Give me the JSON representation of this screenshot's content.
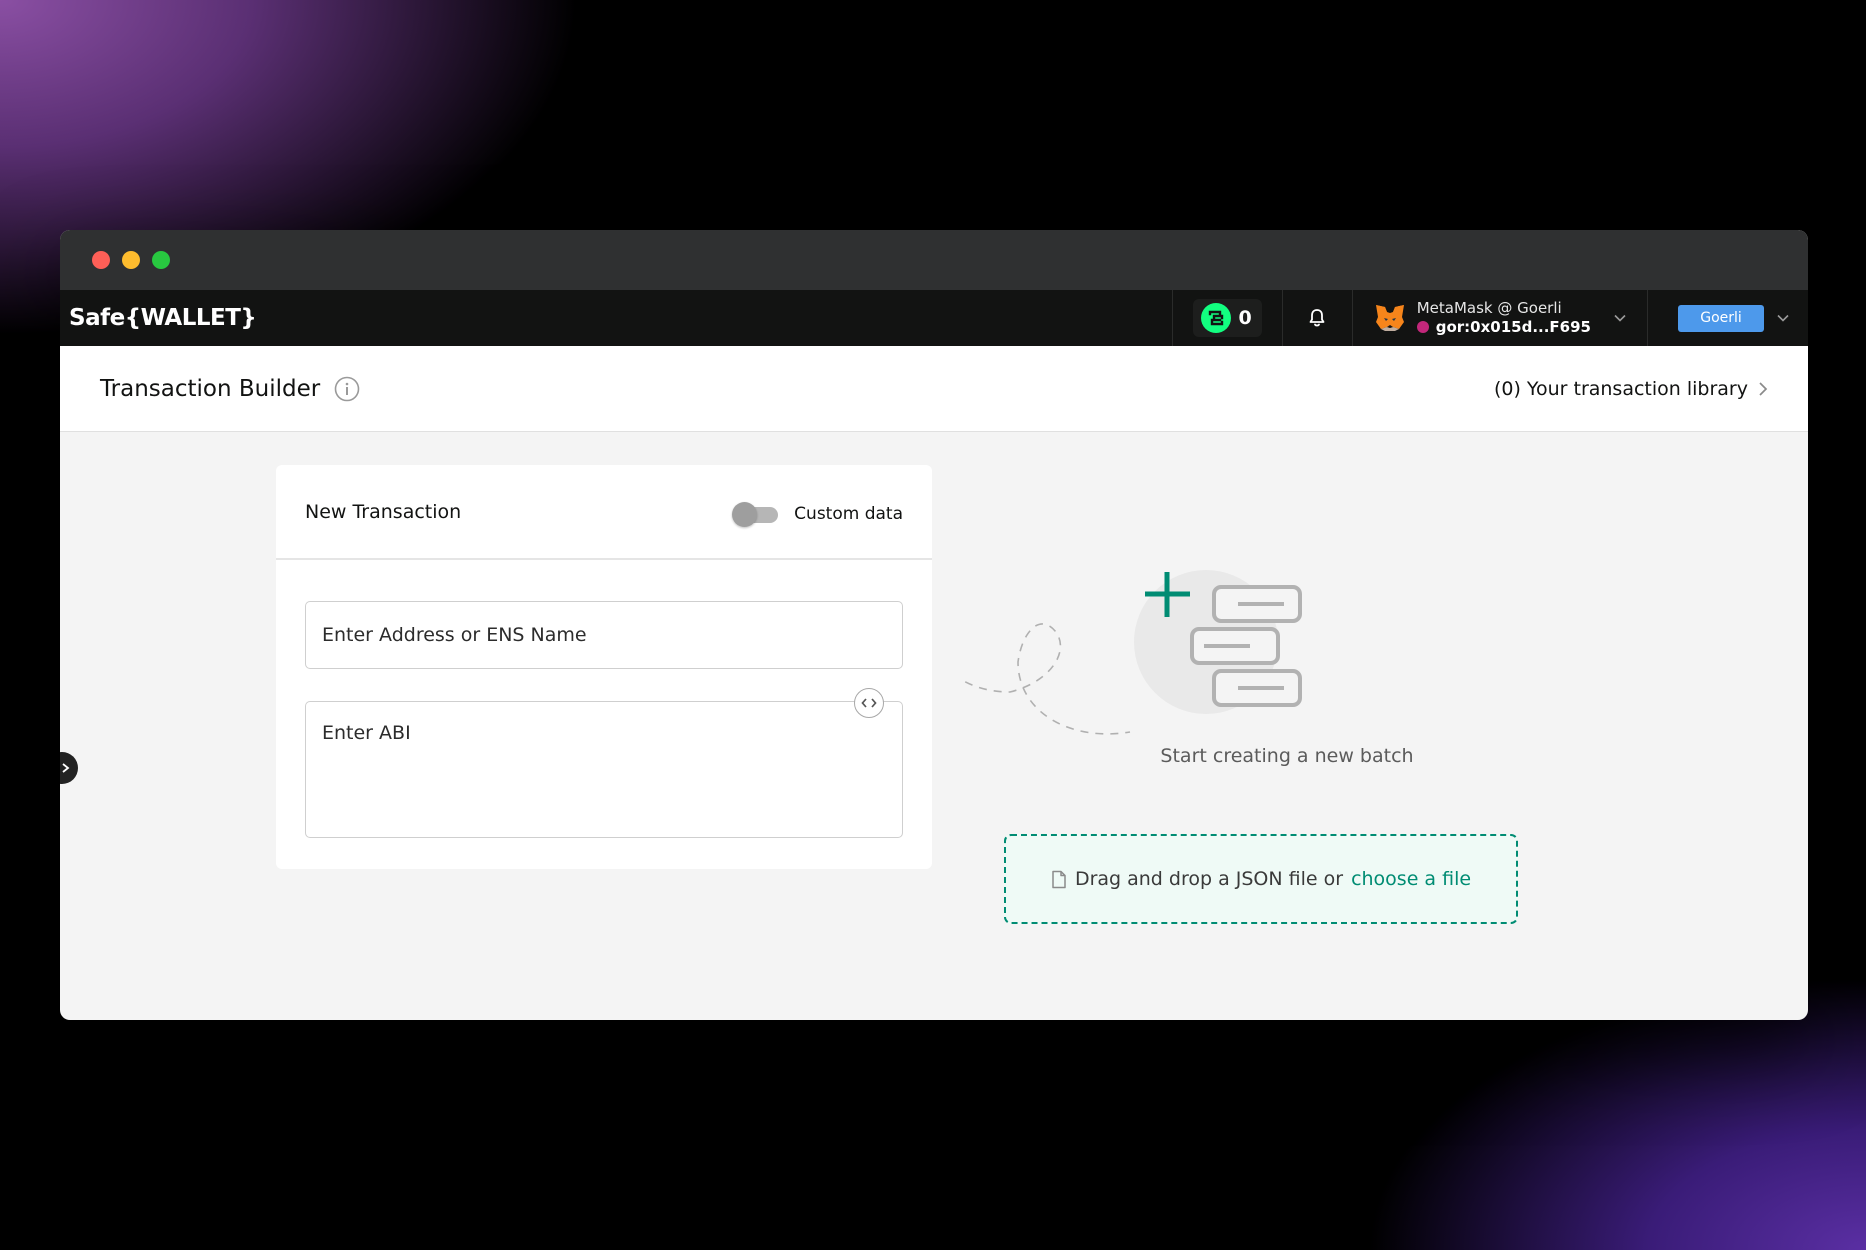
{
  "app": {
    "logo_text": "Safe{WALLET}",
    "pending_tx_count": "0",
    "wallet_name": "MetaMask @ Goerli",
    "wallet_address": "gor:0x015d...F695",
    "network_label": "Goerli"
  },
  "header": {
    "title": "Transaction Builder",
    "library_link": "(0) Your transaction library"
  },
  "new_transaction": {
    "title": "New Transaction",
    "custom_data_label": "Custom data",
    "custom_data_enabled": false,
    "address_placeholder": "Enter Address or ENS Name",
    "abi_placeholder": "Enter ABI"
  },
  "empty_state": {
    "message": "Start creating a new batch",
    "drop_text": "Drag and drop a JSON file or",
    "choose_link": "choose a file"
  },
  "icons": {
    "window_controls": [
      "close-dot-icon",
      "minimize-dot-icon",
      "maximize-dot-icon"
    ],
    "tx_counter": "safe-logo-icon",
    "notifications": "bell-icon",
    "wallet": "metamask-fox-icon",
    "info": "info-icon",
    "library_chevron": "chevron-right-icon",
    "abi_toggle": "code-icon",
    "sidebar_toggle": "chevron-right-icon",
    "file": "file-icon"
  },
  "colors": {
    "accent": "#008c73",
    "network": "#4d99eb",
    "appbar": "#121312",
    "addr_identicon": "#c2277a"
  }
}
